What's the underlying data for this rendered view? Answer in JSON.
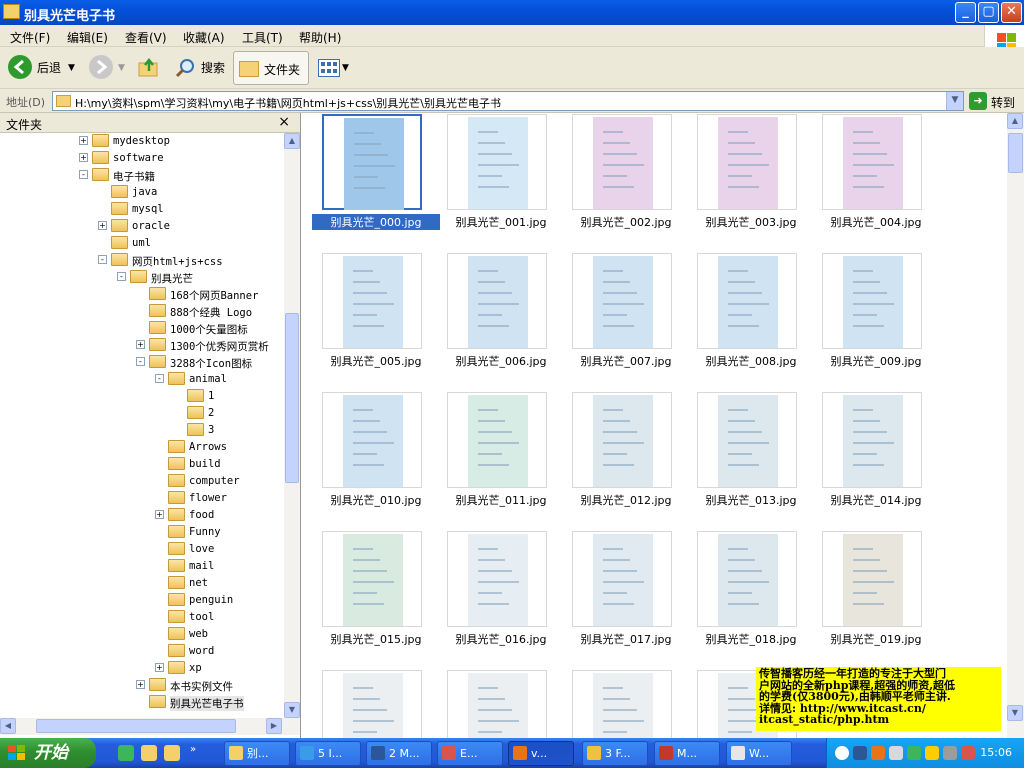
{
  "window": {
    "title": "别具光芒电子书",
    "controls": {
      "minimize": "_",
      "maximize": "▢",
      "close": "✕"
    }
  },
  "menu": [
    "文件(F)",
    "编辑(E)",
    "查看(V)",
    "收藏(A)",
    "工具(T)",
    "帮助(H)"
  ],
  "toolbar": {
    "back_label": "后退",
    "search_label": "搜索",
    "folders_label": "文件夹"
  },
  "address": {
    "label": "地址(D)",
    "value": "H:\\my\\资料\\spm\\学习资料\\my\\电子书籍\\网页html+js+css\\别具光芒\\别具光芒电子书",
    "go_label": "转到"
  },
  "folders_pane": {
    "title": "文件夹",
    "close": "×",
    "items": [
      {
        "label": "mydesktop",
        "depth": 0,
        "exp": "+"
      },
      {
        "label": "software",
        "depth": 0,
        "exp": "+"
      },
      {
        "label": "电子书籍",
        "depth": 0,
        "exp": "-"
      },
      {
        "label": "java",
        "depth": 1,
        "exp": ""
      },
      {
        "label": "mysql",
        "depth": 1,
        "exp": ""
      },
      {
        "label": "oracle",
        "depth": 1,
        "exp": "+"
      },
      {
        "label": "uml",
        "depth": 1,
        "exp": ""
      },
      {
        "label": "网页html+js+css",
        "depth": 1,
        "exp": "-"
      },
      {
        "label": "别具光芒",
        "depth": 2,
        "exp": "-"
      },
      {
        "label": "168个网页Banner",
        "depth": 3,
        "exp": ""
      },
      {
        "label": "888个经典 Logo",
        "depth": 3,
        "exp": ""
      },
      {
        "label": "1000个矢量图标",
        "depth": 3,
        "exp": ""
      },
      {
        "label": "1300个优秀网页赏析",
        "depth": 3,
        "exp": "+"
      },
      {
        "label": "3288个Icon图标",
        "depth": 3,
        "exp": "-"
      },
      {
        "label": "animal",
        "depth": 4,
        "exp": "-"
      },
      {
        "label": "1",
        "depth": 5,
        "exp": ""
      },
      {
        "label": "2",
        "depth": 5,
        "exp": ""
      },
      {
        "label": "3",
        "depth": 5,
        "exp": ""
      },
      {
        "label": "Arrows",
        "depth": 4,
        "exp": ""
      },
      {
        "label": "build",
        "depth": 4,
        "exp": ""
      },
      {
        "label": "computer",
        "depth": 4,
        "exp": ""
      },
      {
        "label": "flower",
        "depth": 4,
        "exp": ""
      },
      {
        "label": "food",
        "depth": 4,
        "exp": "+"
      },
      {
        "label": "Funny",
        "depth": 4,
        "exp": ""
      },
      {
        "label": "love",
        "depth": 4,
        "exp": ""
      },
      {
        "label": "mail",
        "depth": 4,
        "exp": ""
      },
      {
        "label": "net",
        "depth": 4,
        "exp": ""
      },
      {
        "label": "penguin",
        "depth": 4,
        "exp": ""
      },
      {
        "label": "tool",
        "depth": 4,
        "exp": ""
      },
      {
        "label": "web",
        "depth": 4,
        "exp": ""
      },
      {
        "label": "word",
        "depth": 4,
        "exp": ""
      },
      {
        "label": "xp",
        "depth": 4,
        "exp": "+"
      },
      {
        "label": "本书实例文件",
        "depth": 3,
        "exp": "+"
      },
      {
        "label": "别具光芒电子书",
        "depth": 3,
        "exp": "",
        "selected": true
      }
    ]
  },
  "files": [
    {
      "name": "别具光芒_000.jpg",
      "selected": true,
      "tint": "#9fc7ea"
    },
    {
      "name": "别具光芒_001.jpg",
      "tint": "#d5e8f5"
    },
    {
      "name": "别具光芒_002.jpg",
      "tint": "#e9d3ea"
    },
    {
      "name": "别具光芒_003.jpg",
      "tint": "#e9d3ea"
    },
    {
      "name": "别具光芒_004.jpg",
      "tint": "#e9d3ea"
    },
    {
      "name": "别具光芒_005.jpg",
      "tint": "#cfe3f3"
    },
    {
      "name": "别具光芒_006.jpg",
      "tint": "#cfe3f3"
    },
    {
      "name": "别具光芒_007.jpg",
      "tint": "#cfe3f3"
    },
    {
      "name": "别具光芒_008.jpg",
      "tint": "#cfe3f3"
    },
    {
      "name": "别具光芒_009.jpg",
      "tint": "#cfe3f3"
    },
    {
      "name": "别具光芒_010.jpg",
      "tint": "#cfe3f3"
    },
    {
      "name": "别具光芒_011.jpg",
      "tint": "#d7ece4"
    },
    {
      "name": "别具光芒_012.jpg",
      "tint": "#dde8ee"
    },
    {
      "name": "别具光芒_013.jpg",
      "tint": "#dde8ee"
    },
    {
      "name": "别具光芒_014.jpg",
      "tint": "#dde8ee"
    },
    {
      "name": "别具光芒_015.jpg",
      "tint": "#d9ebe1"
    },
    {
      "name": "别具光芒_016.jpg",
      "tint": "#e6eef3"
    },
    {
      "name": "别具光芒_017.jpg",
      "tint": "#e1eaf0"
    },
    {
      "name": "别具光芒_018.jpg",
      "tint": "#dde8ee"
    },
    {
      "name": "别具光芒_019.jpg",
      "tint": "#e8e6dc"
    },
    {
      "name": "",
      "tint": "#eceff2"
    },
    {
      "name": "",
      "tint": "#eceff2"
    },
    {
      "name": "",
      "tint": "#eceff2"
    },
    {
      "name": "",
      "tint": "#eceff2"
    }
  ],
  "ad_overlay": {
    "lines": [
      "传智播客历经一年打造的专注于大型门",
      "户网站的全新php课程,超强的师资,超低",
      "的学费(仅3800元),由韩顺平老师主讲.",
      "详情见: http://www.itcast.cn/",
      "itcast_static/php.htm"
    ]
  },
  "taskbar": {
    "start_label": "开始",
    "tasks": [
      {
        "label": "别...",
        "color": "#f3d06a"
      },
      {
        "label": "5 I...",
        "color": "#3a9be6"
      },
      {
        "label": "2 M...",
        "color": "#2b5797"
      },
      {
        "label": "E...",
        "color": "#d9534f"
      },
      {
        "label": "v...",
        "color": "#e8741a",
        "active": true
      },
      {
        "label": "3 F...",
        "color": "#f0c040"
      },
      {
        "label": "M...",
        "color": "#c0392b"
      },
      {
        "label": "W...",
        "color": "#e6e6e6"
      }
    ],
    "clock": "15:06"
  },
  "colors": {
    "titlebar": "#0550d8",
    "selection": "#316ac5",
    "taskbar": "#245edb",
    "start": "#2f8f2f",
    "ad_background": "#ffff00"
  }
}
